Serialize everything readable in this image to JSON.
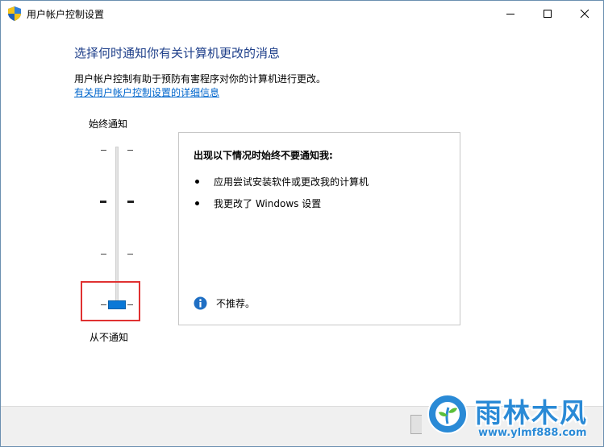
{
  "window": {
    "title": "用户帐户控制设置"
  },
  "content": {
    "heading": "选择何时通知你有关计算机更改的消息",
    "description": "用户帐户控制有助于预防有害程序对你的计算机进行更改。",
    "help_link": "有关用户帐户控制设置的详细信息"
  },
  "slider": {
    "label_top": "始终通知",
    "label_bottom": "从不通知",
    "levels": 4,
    "selected_level": 1
  },
  "panel": {
    "heading": "出现以下情况时始终不要通知我:",
    "bullets": [
      "应用尝试安装软件或更改我的计算机",
      "我更改了 Windows 设置"
    ],
    "note": "不推荐。"
  },
  "watermark": {
    "title": "雨林木风",
    "url": "www.ylmf888.com"
  },
  "colors": {
    "heading": "#1e3f8a",
    "link": "#0066cc",
    "thumb": "#0a78d7",
    "highlight": "#e03131",
    "info_icon": "#1f6fc4"
  },
  "icons": {
    "app": "uac-shield-icon",
    "info": "info-icon",
    "minimize": "minimize-icon",
    "maximize": "maximize-icon",
    "close": "close-icon"
  }
}
